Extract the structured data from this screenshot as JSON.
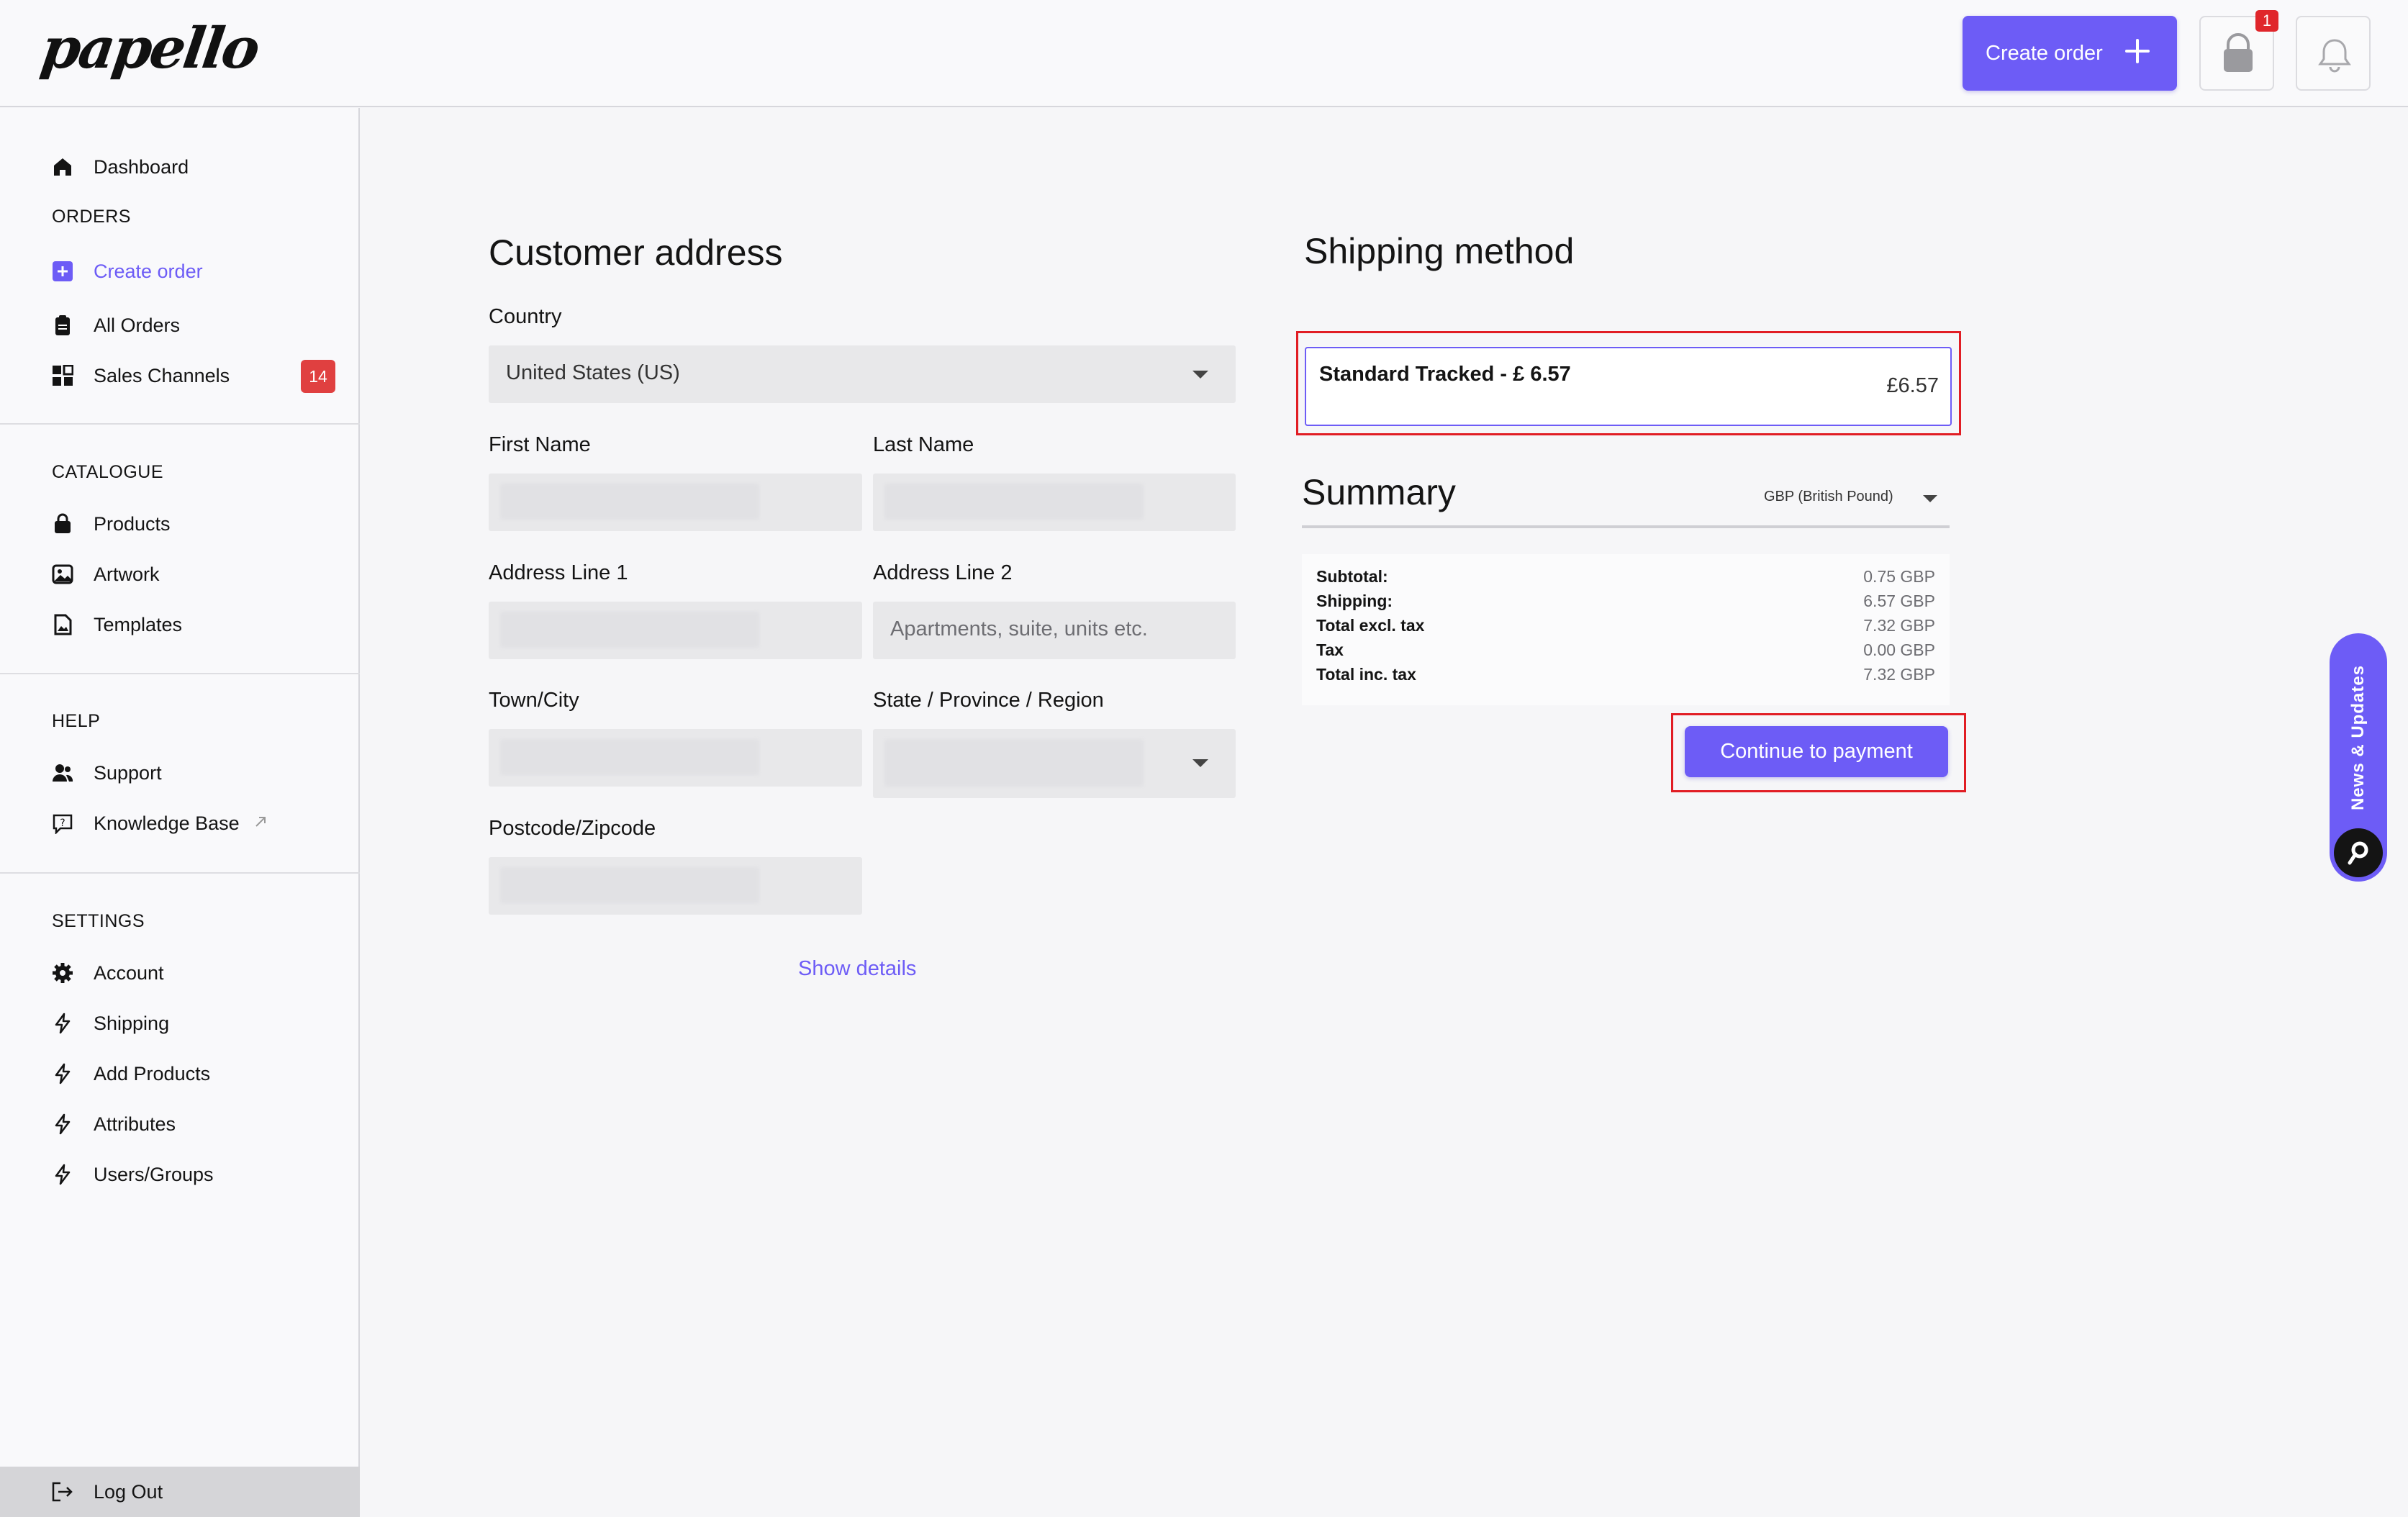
{
  "app": {
    "logo": "papello"
  },
  "header": {
    "create_order_label": "Create order",
    "cart_badge": "1"
  },
  "sidebar": {
    "dashboard": "Dashboard",
    "orders_title": "ORDERS",
    "create_order": "Create order",
    "all_orders": "All Orders",
    "sales_channels": "Sales Channels",
    "sales_channels_badge": "14",
    "catalogue_title": "CATALOGUE",
    "products": "Products",
    "artwork": "Artwork",
    "templates": "Templates",
    "help_title": "HELP",
    "support": "Support",
    "knowledge_base": "Knowledge Base",
    "settings_title": "SETTINGS",
    "account": "Account",
    "shipping": "Shipping",
    "add_products": "Add Products",
    "attributes": "Attributes",
    "users_groups": "Users/Groups",
    "log_out": "Log Out"
  },
  "address": {
    "title": "Customer address",
    "country_label": "Country",
    "country_value": "United States (US)",
    "first_name_label": "First Name",
    "last_name_label": "Last Name",
    "address1_label": "Address Line 1",
    "address2_label": "Address Line 2",
    "address2_placeholder": "Apartments, suite, units etc.",
    "town_label": "Town/City",
    "state_label": "State / Province / Region",
    "postcode_label": "Postcode/Zipcode",
    "show_details": "Show details"
  },
  "shipping": {
    "title": "Shipping method",
    "option_name": "Standard Tracked - £ 6.57",
    "option_price": "£6.57"
  },
  "summary": {
    "title": "Summary",
    "currency": "GBP (British Pound)",
    "rows": [
      {
        "k": "Subtotal:",
        "v": "0.75 GBP"
      },
      {
        "k": "Shipping:",
        "v": "6.57 GBP"
      },
      {
        "k": "Total excl. tax",
        "v": "7.32 GBP"
      },
      {
        "k": "Tax",
        "v": "0.00 GBP"
      },
      {
        "k": "Total inc. tax",
        "v": "7.32 GBP"
      }
    ],
    "continue_label": "Continue to payment"
  },
  "news_tab": {
    "label": "News & Updates"
  },
  "colors": {
    "accent": "#6d5cf6",
    "highlight": "#e11d24",
    "badge": "#e04040"
  }
}
